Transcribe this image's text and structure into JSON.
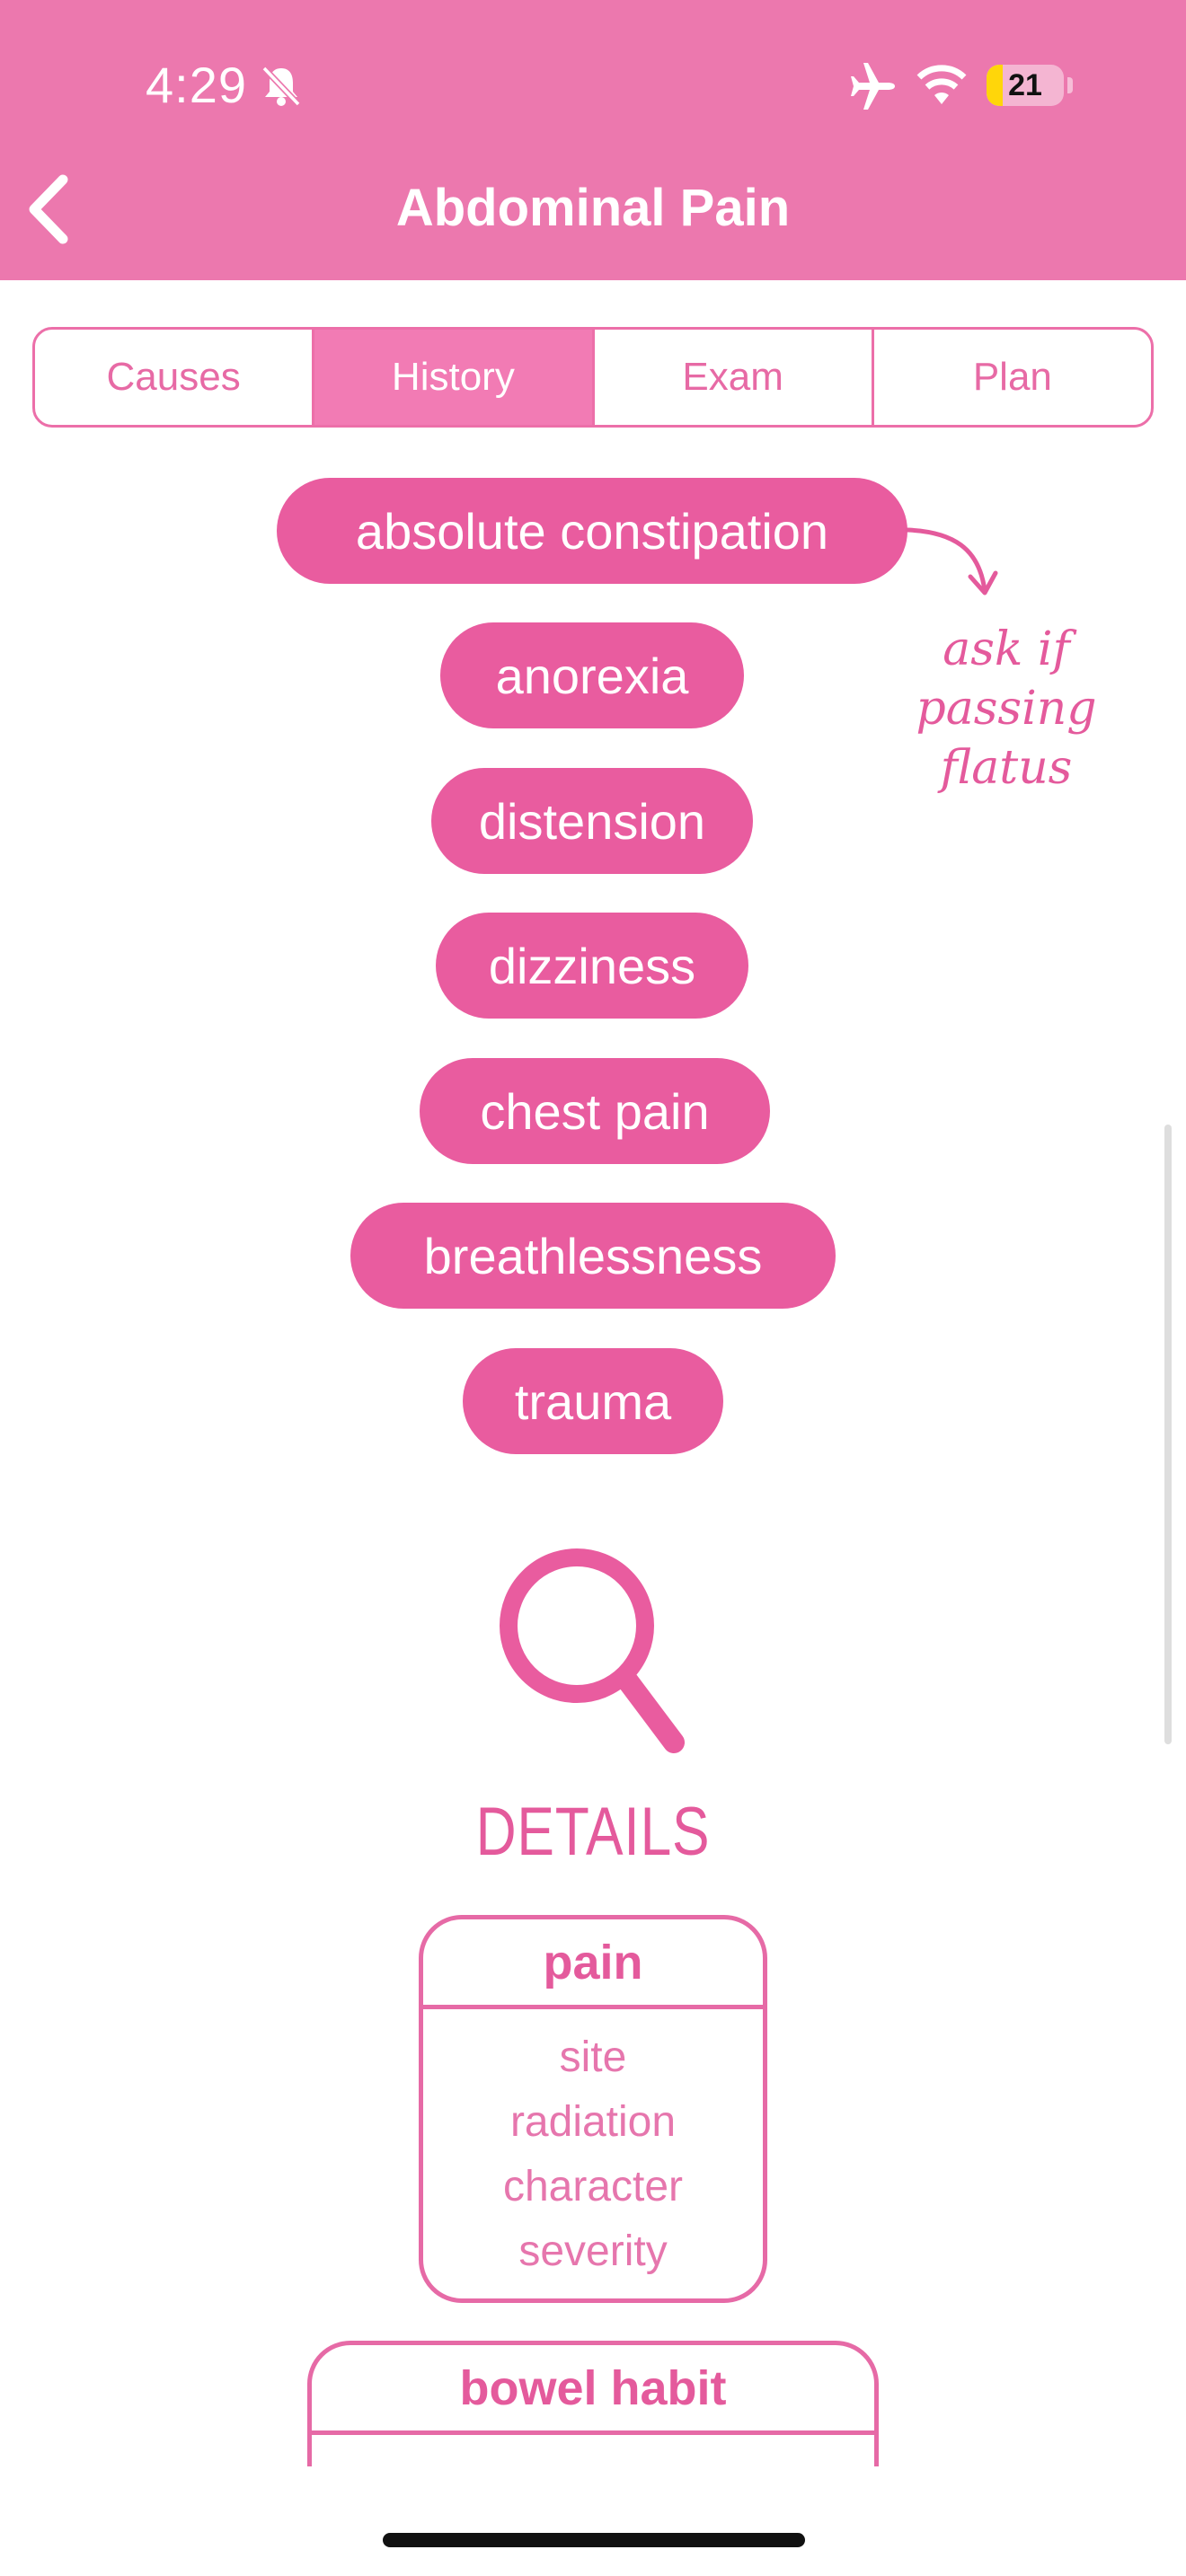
{
  "status_bar": {
    "time": "4:29",
    "battery": "21",
    "battery_level": 0.21
  },
  "nav": {
    "title": "Abdominal Pain"
  },
  "tabs": [
    {
      "label": "Causes",
      "active": false
    },
    {
      "label": "History",
      "active": true
    },
    {
      "label": "Exam",
      "active": false
    },
    {
      "label": "Plan",
      "active": false
    }
  ],
  "symptoms": [
    "absolute constipation",
    "anorexia",
    "distension",
    "dizziness",
    "chest pain",
    "breathlessness",
    "trauma"
  ],
  "note": {
    "lines": [
      "ask if",
      "passing",
      "flatus"
    ]
  },
  "details": {
    "heading": "DETAILS",
    "pain": {
      "title": "pain",
      "items": [
        "site",
        "radiation",
        "character",
        "severity"
      ]
    },
    "bowel": {
      "title": "bowel habit"
    }
  },
  "colors": {
    "header": "#ec78ae",
    "accent": "#e95c9f",
    "tab_active": "#f27bb4"
  },
  "icons": [
    "back-chevron-icon",
    "bell-slash-icon",
    "airplane-icon",
    "wifi-icon",
    "magnifier-icon",
    "arrow-icon"
  ]
}
